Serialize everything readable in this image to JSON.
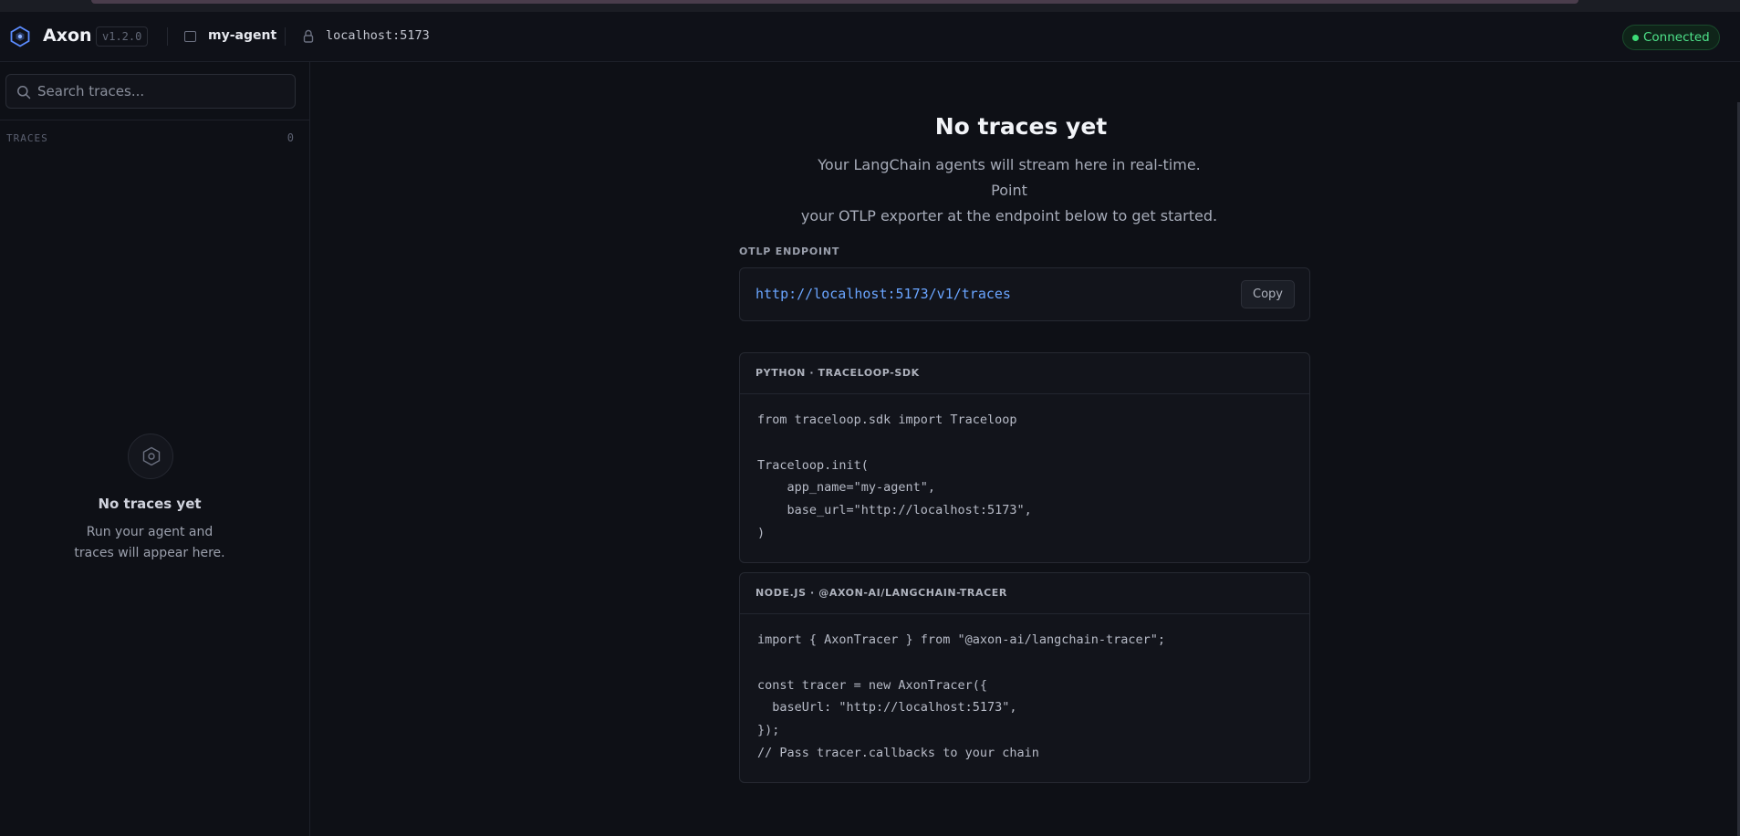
{
  "header": {
    "brand": "Axon",
    "version": "v1.2.0",
    "project": "my-agent",
    "host": "localhost:5173",
    "status": "Connected"
  },
  "sidebar": {
    "search_placeholder": "Search traces...",
    "section_label": "TRACES",
    "count": "0",
    "empty_title": "No traces yet",
    "empty_line1": "Run your agent and",
    "empty_line2": "traces will appear here."
  },
  "main": {
    "title": "No traces yet",
    "desc_line1": "Your LangChain agents will stream here in real-time. Point",
    "desc_line2": "your OTLP exporter at the endpoint below to get started.",
    "endpoint_label": "OTLP ENDPOINT",
    "endpoint_url": "http://localhost:5173/v1/traces",
    "copy_label": "Copy",
    "python_card": {
      "title": "PYTHON · TRACELOOP-SDK",
      "code": "from traceloop.sdk import Traceloop\n\nTraceloop.init(\n    app_name=\"my-agent\",\n    base_url=\"http://localhost:5173\",\n)"
    },
    "node_card": {
      "title": "NODE.JS · @AXON-AI/LANGCHAIN-TRACER",
      "code": "import { AxonTracer } from \"@axon-ai/langchain-tracer\";\n\nconst tracer = new AxonTracer({\n  baseUrl: \"http://localhost:5173\",\n});\n// Pass tracer.callbacks to your chain"
    }
  },
  "colors": {
    "accent": "#6aa5ff",
    "status_green": "#4ee38a",
    "background": "#0e1016"
  },
  "icons": {
    "logo": "hexagon-logo-icon",
    "project": "folder-icon",
    "host": "lock-icon",
    "search": "search-icon",
    "empty": "hexagon-icon"
  }
}
